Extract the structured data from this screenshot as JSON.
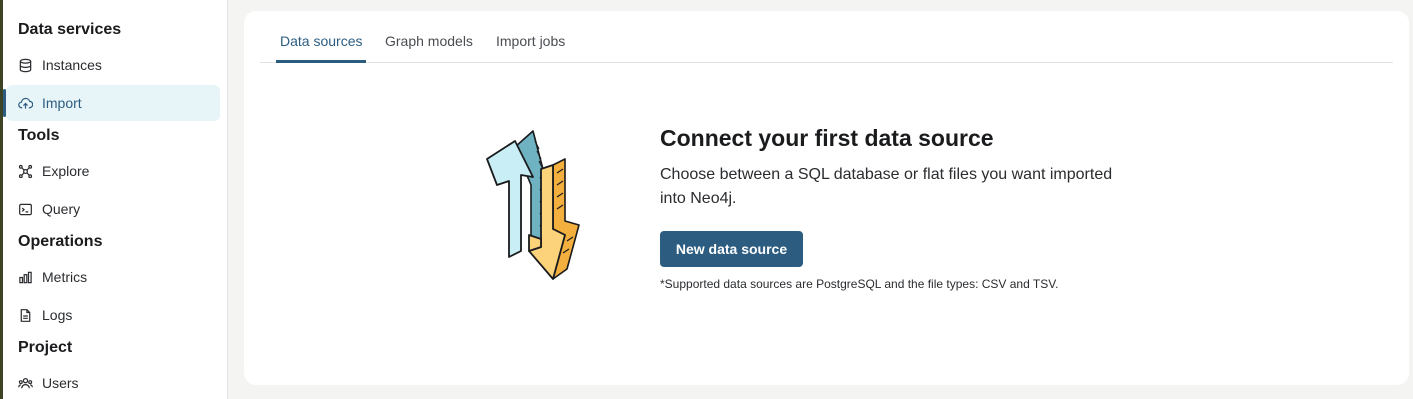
{
  "sidebar": {
    "sections": [
      {
        "title": "Data services"
      },
      {
        "title": "Tools"
      },
      {
        "title": "Operations"
      },
      {
        "title": "Project"
      }
    ],
    "items": [
      {
        "label": "Instances",
        "icon": "database-icon"
      },
      {
        "label": "Import",
        "icon": "cloud-upload-icon",
        "active": true
      },
      {
        "label": "Explore",
        "icon": "graph-icon"
      },
      {
        "label": "Query",
        "icon": "terminal-icon"
      },
      {
        "label": "Metrics",
        "icon": "bar-chart-icon"
      },
      {
        "label": "Logs",
        "icon": "document-icon"
      },
      {
        "label": "Users",
        "icon": "users-icon"
      }
    ]
  },
  "tabs": [
    {
      "label": "Data sources",
      "active": true
    },
    {
      "label": "Graph models"
    },
    {
      "label": "Import jobs"
    }
  ],
  "empty_state": {
    "title": "Connect your first data source",
    "description": "Choose between a SQL database or flat files you want imported into Neo4j.",
    "button_label": "New data source",
    "note": "*Supported data sources are PostgreSQL and the file types: CSV and TSV."
  },
  "colors": {
    "accent": "#2c5d80",
    "active_bg": "#e8f5f8",
    "arrow_up": "#c9eef6",
    "arrow_down": "#fcd27a"
  }
}
